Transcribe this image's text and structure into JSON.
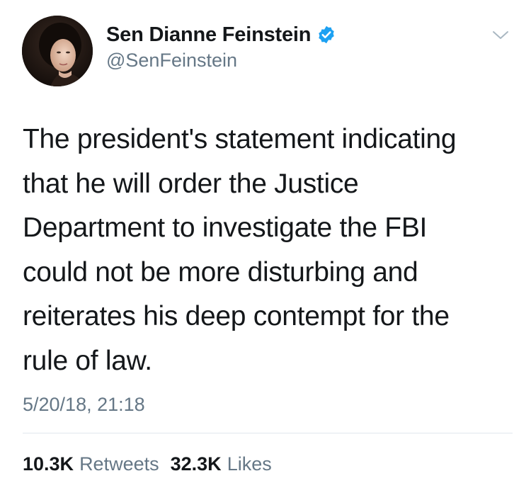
{
  "user": {
    "display_name": "Sen Dianne Feinstein",
    "handle": "@SenFeinstein",
    "verified": true,
    "avatar_icon": "profile-photo"
  },
  "tweet": {
    "text": "The president's statement indicating\nthat he will order the Justice\nDepartment to investigate the FBI\ncould not be more disturbing and\nreiterates his deep contempt for the\nrule of law.",
    "timestamp": "5/20/18, 21:18"
  },
  "stats": {
    "retweets_count": "10.3K",
    "retweets_label": "Retweets",
    "likes_count": "32.3K",
    "likes_label": "Likes"
  },
  "colors": {
    "verified_blue": "#1da1f2",
    "muted_gray": "#657786",
    "text_dark": "#14171a",
    "divider": "#e1e8ed"
  },
  "icons": {
    "verified": "verified-badge-icon",
    "menu": "chevron-down-icon"
  }
}
